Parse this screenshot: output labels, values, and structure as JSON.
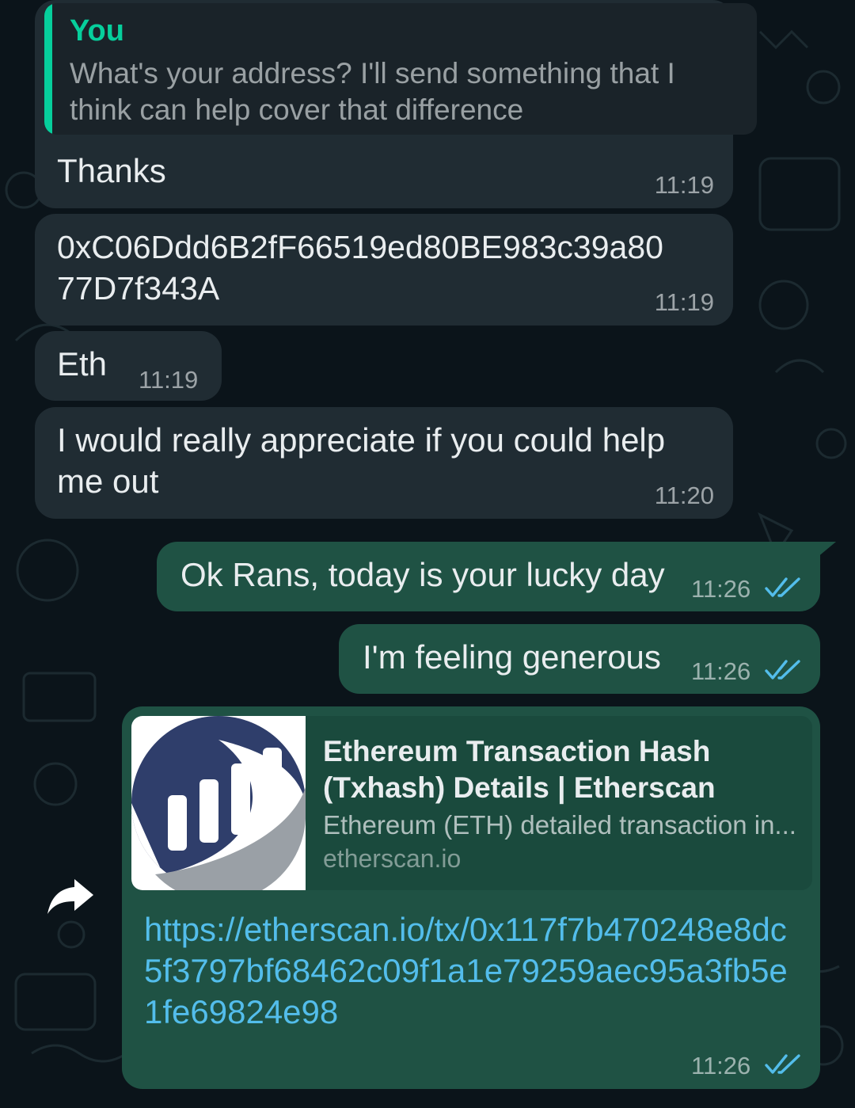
{
  "messages": [
    {
      "direction": "incoming",
      "reply_to": {
        "author": "You",
        "text": "What's your address? I'll send something that I think can help cover that difference"
      },
      "text": "Thanks",
      "time": "11:19"
    },
    {
      "direction": "incoming",
      "text": "0xC06Ddd6B2fF66519ed80BE983c39a80\n77D7f343A",
      "time": "11:19"
    },
    {
      "direction": "incoming",
      "text": "Eth",
      "time": "11:19"
    },
    {
      "direction": "incoming",
      "text": "I would really appreciate if you could help\nme out",
      "time": "11:20"
    },
    {
      "direction": "outgoing",
      "text": "Ok Rans, today is your lucky day",
      "time": "11:26",
      "status": "read"
    },
    {
      "direction": "outgoing",
      "text": "I'm feeling generous",
      "time": "11:26",
      "status": "read"
    },
    {
      "direction": "outgoing",
      "link_preview": {
        "title": "Ethereum Transaction Hash (Txhash) Details | Etherscan",
        "description": "Ethereum (ETH) detailed transaction in...",
        "domain": "etherscan.io",
        "thumbnail_icon": "etherscan-logo"
      },
      "text": "https://etherscan.io/tx/0x117f7b470248e8dc5f3797bf68462c09f1a1e79259aec95a3fb5e1fe69824e98",
      "time": "11:26",
      "status": "read"
    }
  ],
  "icons": {
    "forward": "forward-arrow-icon",
    "read_receipt": "double-check-icon"
  },
  "colors": {
    "background": "#0b141a",
    "incoming_bubble": "#202c33",
    "outgoing_bubble": "#1f5244",
    "read_tick": "#53bdeb",
    "link": "#53bdeb",
    "quote_accent": "#06cf9c"
  }
}
